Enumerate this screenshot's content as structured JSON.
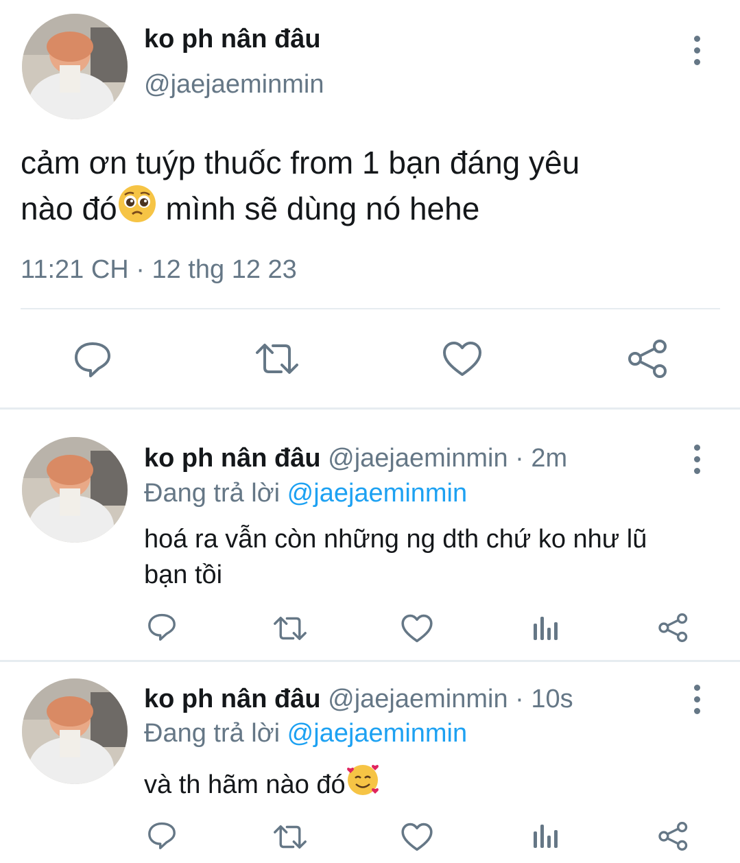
{
  "main_tweet": {
    "display_name": "ko ph nân đâu",
    "handle": "@jaejaeminmin",
    "text_line1": "cảm ơn tuýp thuốc from 1 bạn đáng yêu",
    "text_line2_a": "nào đó",
    "text_line2_b": " mình sẽ dùng nó hehe",
    "timestamp": "11:21 CH · 12 thg 12 23"
  },
  "replies": [
    {
      "display_name": "ko ph nân đâu",
      "handle": "@jaejaeminmin",
      "time": " · 2m",
      "replying_prefix": "Đang trả lời ",
      "replying_to": "@jaejaeminmin",
      "text_line1": "hoá ra vẫn còn những ng dth chứ ko như lũ",
      "text_line2": "bạn tồi"
    },
    {
      "display_name": "ko ph nân đâu",
      "handle": "@jaejaeminmin",
      "time": " · 10s",
      "replying_prefix": "Đang trả lời ",
      "replying_to": "@jaejaeminmin",
      "text_line1": "và th hãm nào đó"
    }
  ],
  "icons": {
    "reply": "reply-icon",
    "retweet": "retweet-icon",
    "like": "heart-icon",
    "stats": "stats-icon",
    "share": "share-icon",
    "more": "more-vertical-icon"
  },
  "colors": {
    "icon_gray": "#657786",
    "link_blue": "#1da1f2",
    "divider": "#e6ecf0"
  }
}
